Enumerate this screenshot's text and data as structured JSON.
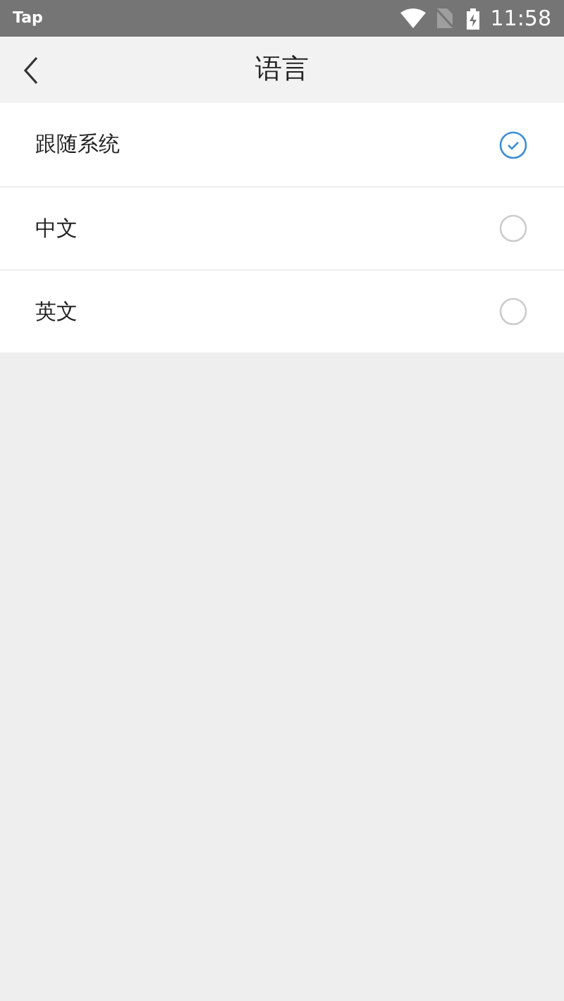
{
  "status_bar": {
    "app": "Tap",
    "time": "11:58"
  },
  "header": {
    "title": "语言"
  },
  "options": [
    {
      "label": "跟随系统",
      "selected": true
    },
    {
      "label": "中文",
      "selected": false
    },
    {
      "label": "英文",
      "selected": false
    }
  ]
}
